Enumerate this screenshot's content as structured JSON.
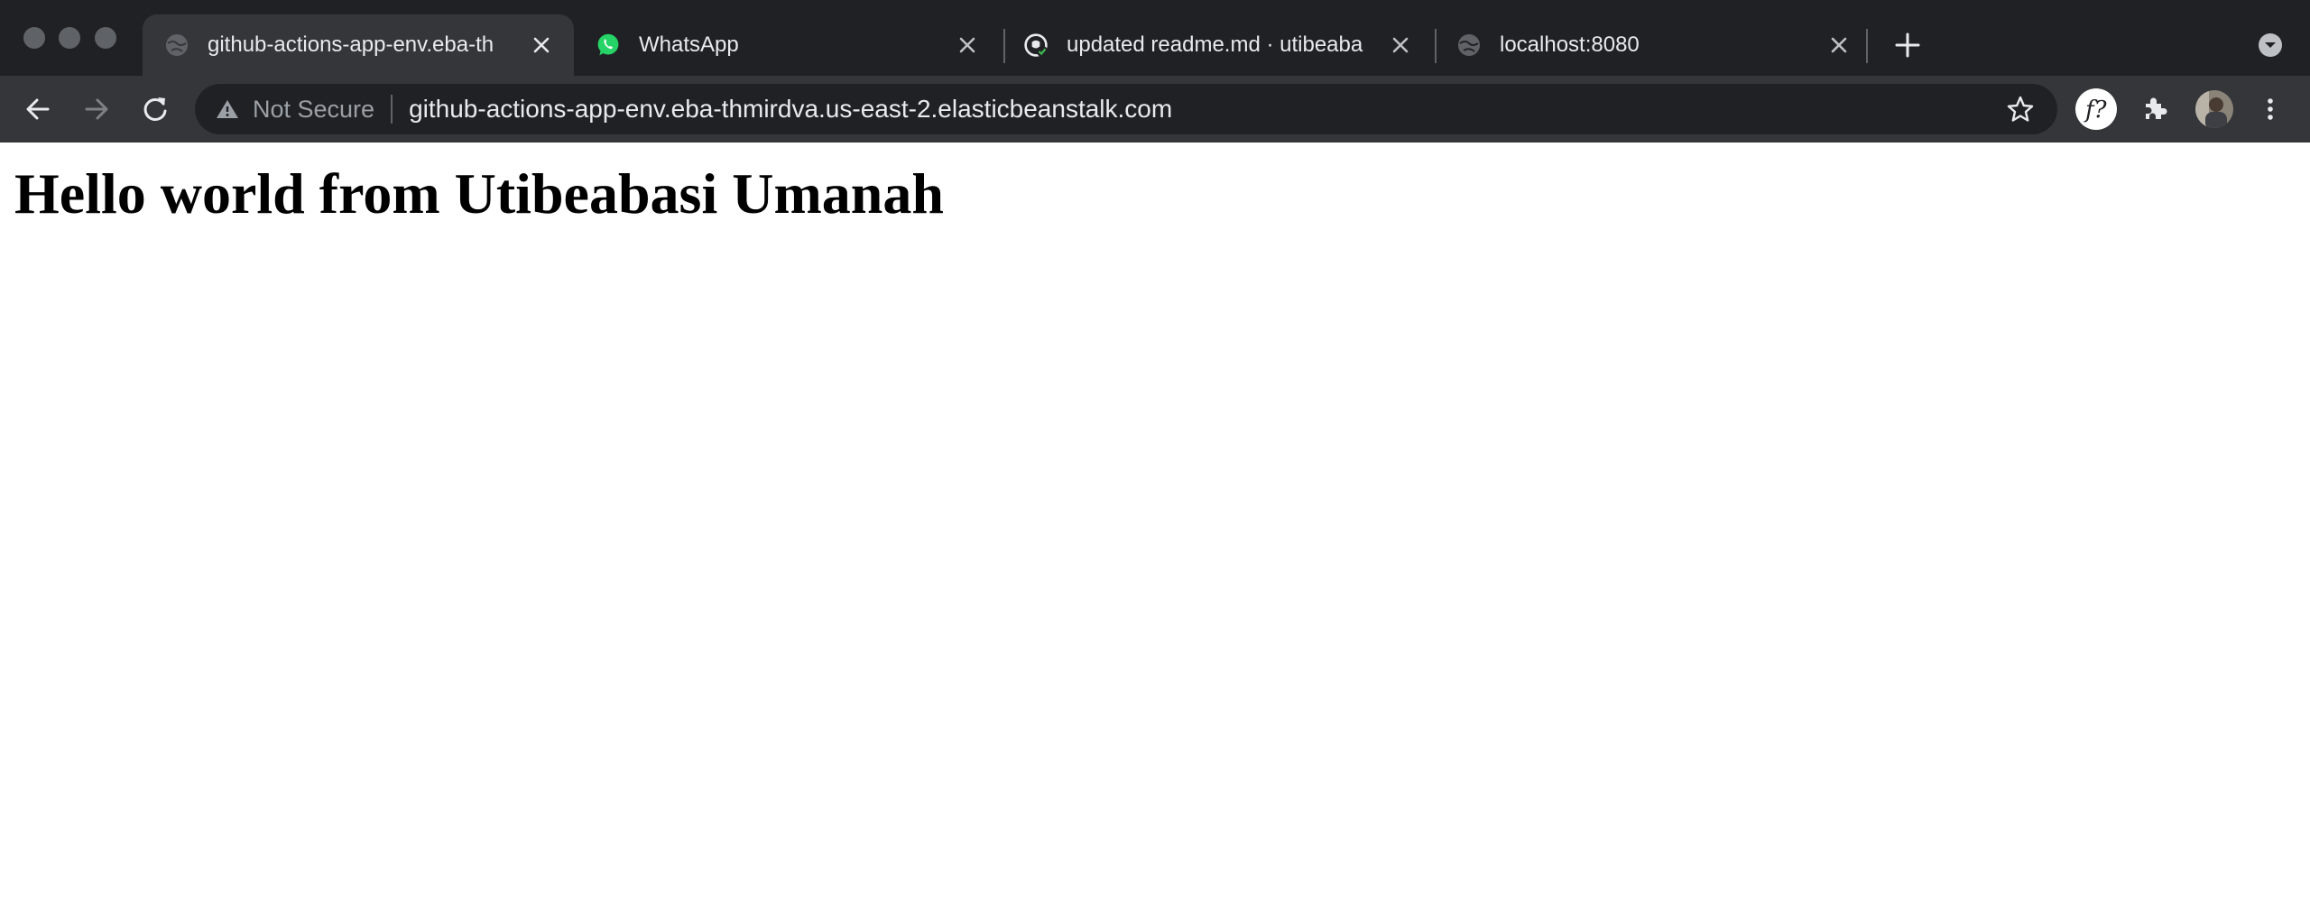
{
  "browser": {
    "tabs": [
      {
        "title": "github-actions-app-env.eba-th",
        "favicon": "globe-icon",
        "active": true
      },
      {
        "title": "WhatsApp",
        "favicon": "whatsapp-icon",
        "active": false
      },
      {
        "title": "updated readme.md · utibeaba",
        "favicon": "github-icon",
        "active": false
      },
      {
        "title": "localhost:8080",
        "favicon": "globe-icon",
        "active": false
      }
    ],
    "security_label": "Not Secure",
    "url": "github-actions-app-env.eba-thmirdva.us-east-2.elasticbeanstalk.com"
  },
  "page": {
    "heading": "Hello world from Utibeabasi Umanah"
  },
  "colors": {
    "frame": "#202124",
    "toolbar": "#35363a",
    "whatsapp": "#25d366",
    "text": "#e8eaed"
  }
}
